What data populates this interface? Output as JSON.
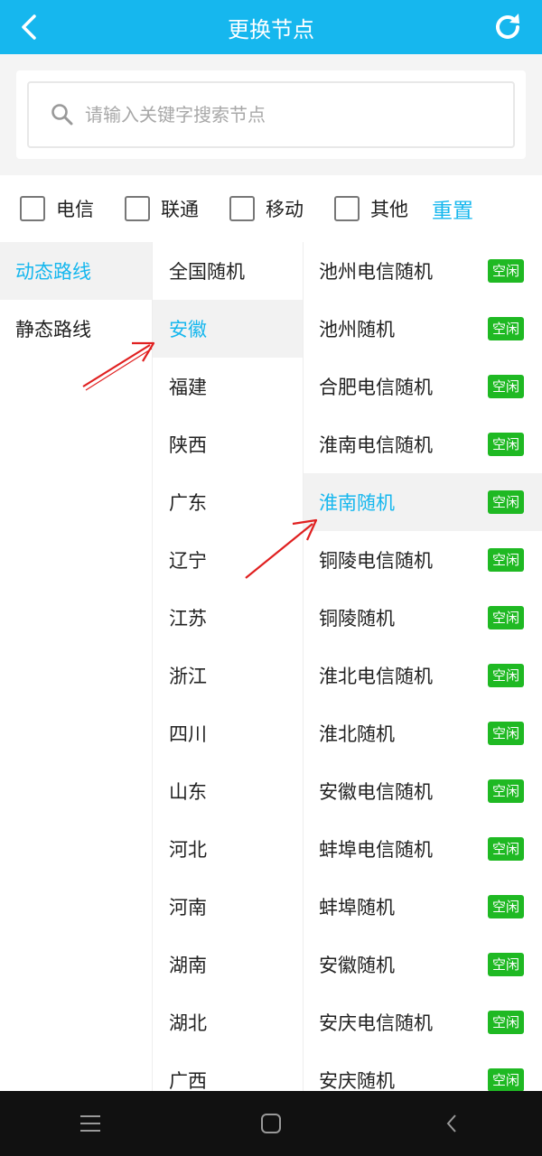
{
  "header": {
    "title": "更换节点"
  },
  "search": {
    "placeholder": "请输入关键字搜索节点"
  },
  "filters": [
    {
      "label": "电信",
      "checked": false
    },
    {
      "label": "联通",
      "checked": false
    },
    {
      "label": "移动",
      "checked": false
    },
    {
      "label": "其他",
      "checked": false
    }
  ],
  "reset_label": "重置",
  "route_types": [
    {
      "label": "动态路线",
      "active": true
    },
    {
      "label": "静态路线",
      "active": false
    }
  ],
  "regions": [
    {
      "label": "全国随机",
      "active": false
    },
    {
      "label": "安徽",
      "active": true
    },
    {
      "label": "福建",
      "active": false
    },
    {
      "label": "陕西",
      "active": false
    },
    {
      "label": "广东",
      "active": false
    },
    {
      "label": "辽宁",
      "active": false
    },
    {
      "label": "江苏",
      "active": false
    },
    {
      "label": "浙江",
      "active": false
    },
    {
      "label": "四川",
      "active": false
    },
    {
      "label": "山东",
      "active": false
    },
    {
      "label": "河北",
      "active": false
    },
    {
      "label": "河南",
      "active": false
    },
    {
      "label": "湖南",
      "active": false
    },
    {
      "label": "湖北",
      "active": false
    },
    {
      "label": "广西",
      "active": false
    }
  ],
  "nodes": [
    {
      "label": "池州电信随机",
      "status": "空闲",
      "active": false
    },
    {
      "label": "池州随机",
      "status": "空闲",
      "active": false
    },
    {
      "label": "合肥电信随机",
      "status": "空闲",
      "active": false
    },
    {
      "label": "淮南电信随机",
      "status": "空闲",
      "active": false
    },
    {
      "label": "淮南随机",
      "status": "空闲",
      "active": true
    },
    {
      "label": "铜陵电信随机",
      "status": "空闲",
      "active": false
    },
    {
      "label": "铜陵随机",
      "status": "空闲",
      "active": false
    },
    {
      "label": "淮北电信随机",
      "status": "空闲",
      "active": false
    },
    {
      "label": "淮北随机",
      "status": "空闲",
      "active": false
    },
    {
      "label": "安徽电信随机",
      "status": "空闲",
      "active": false
    },
    {
      "label": "蚌埠电信随机",
      "status": "空闲",
      "active": false
    },
    {
      "label": "蚌埠随机",
      "status": "空闲",
      "active": false
    },
    {
      "label": "安徽随机",
      "status": "空闲",
      "active": false
    },
    {
      "label": "安庆电信随机",
      "status": "空闲",
      "active": false
    },
    {
      "label": "安庆随机",
      "status": "空闲",
      "active": false
    }
  ],
  "colors": {
    "accent": "#16b7ee",
    "badge": "#1fb923",
    "annotation": "#e02020"
  },
  "icons": {
    "back": "chevron-left-icon",
    "refresh": "refresh-icon",
    "search": "search-icon"
  }
}
